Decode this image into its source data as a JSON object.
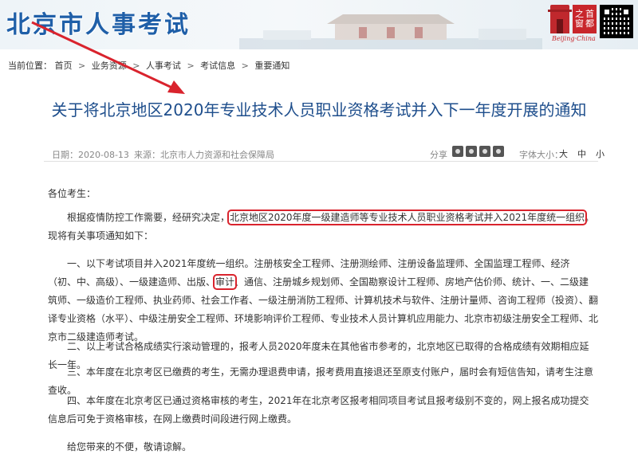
{
  "header": {
    "site_title": "北京市人事考试",
    "seal_chars": [
      "之",
      "首",
      "窗",
      "都"
    ],
    "seal_caption": "Beijing·China"
  },
  "breadcrumb": {
    "prefix": "当前位置：",
    "items": [
      "首页",
      "业务资源",
      "人事考试",
      "考试信息",
      "重要通知"
    ]
  },
  "article": {
    "title": "关于将北京地区2020年专业技术人员职业资格考试并入下一年度开展的通知",
    "date": "日期：2020-08-13",
    "source": "来源：北京市人力资源和社会保障局",
    "share_label": "分享",
    "font_label": "字体大小：",
    "font_sizes": [
      "大",
      "中",
      "小"
    ]
  },
  "content": {
    "greeting": "各位考生：",
    "p1_before": "根据疫情防控工作需要，经研究决定，",
    "p1_highlight": "北京地区2020年度一级建造师等专业技术人员职业资格考试并入2021年度统一组织",
    "p1_after": "。现将有关事项通知如下：",
    "p2_before": "一、以下考试项目并入2021年度统一组织。注册核安全工程师、注册测绘师、注册设备监理师、全国监理工程师、经济（初、中、高级）、一级建造师、出版、",
    "p2_highlight": "审计",
    "p2_after": "、通信、注册城乡规划师、全国勘察设计工程师、房地产估价师、统计、一、二级建筑师、一级造价工程师、执业药师、社会工作者、一级注册消防工程师、计算机技术与软件、注册计量师、咨询工程师（投资）、翻译专业资格（水平）、中级注册安全工程师、环境影响评价工程师、专业技术人员计算机应用能力、北京市初级注册安全工程师、北京市二级建造师考试。",
    "p3": "二、以上考试合格成绩实行滚动管理的，报考人员2020年度未在其他省市参考的，北京地区已取得的合格成绩有效期相应延长一年。",
    "p4": "三、本年度在北京考区已缴费的考生，无需办理退费申请，报考费用直接退还至原支付账户，届时会有短信告知，请考生注意查收。",
    "p5": "四、本年度在北京考区已通过资格审核的考生，2021年在北京考区报考相同项目考试且报考级别不变的，网上报名成功提交信息后可免于资格审核，在网上缴费时间段进行网上缴费。",
    "p6": "给您带来的不便，敬请谅解。"
  },
  "colors": {
    "title_blue": "#1e4e8c",
    "site_blue": "#1f5fa8",
    "highlight_red": "#d9232d"
  }
}
